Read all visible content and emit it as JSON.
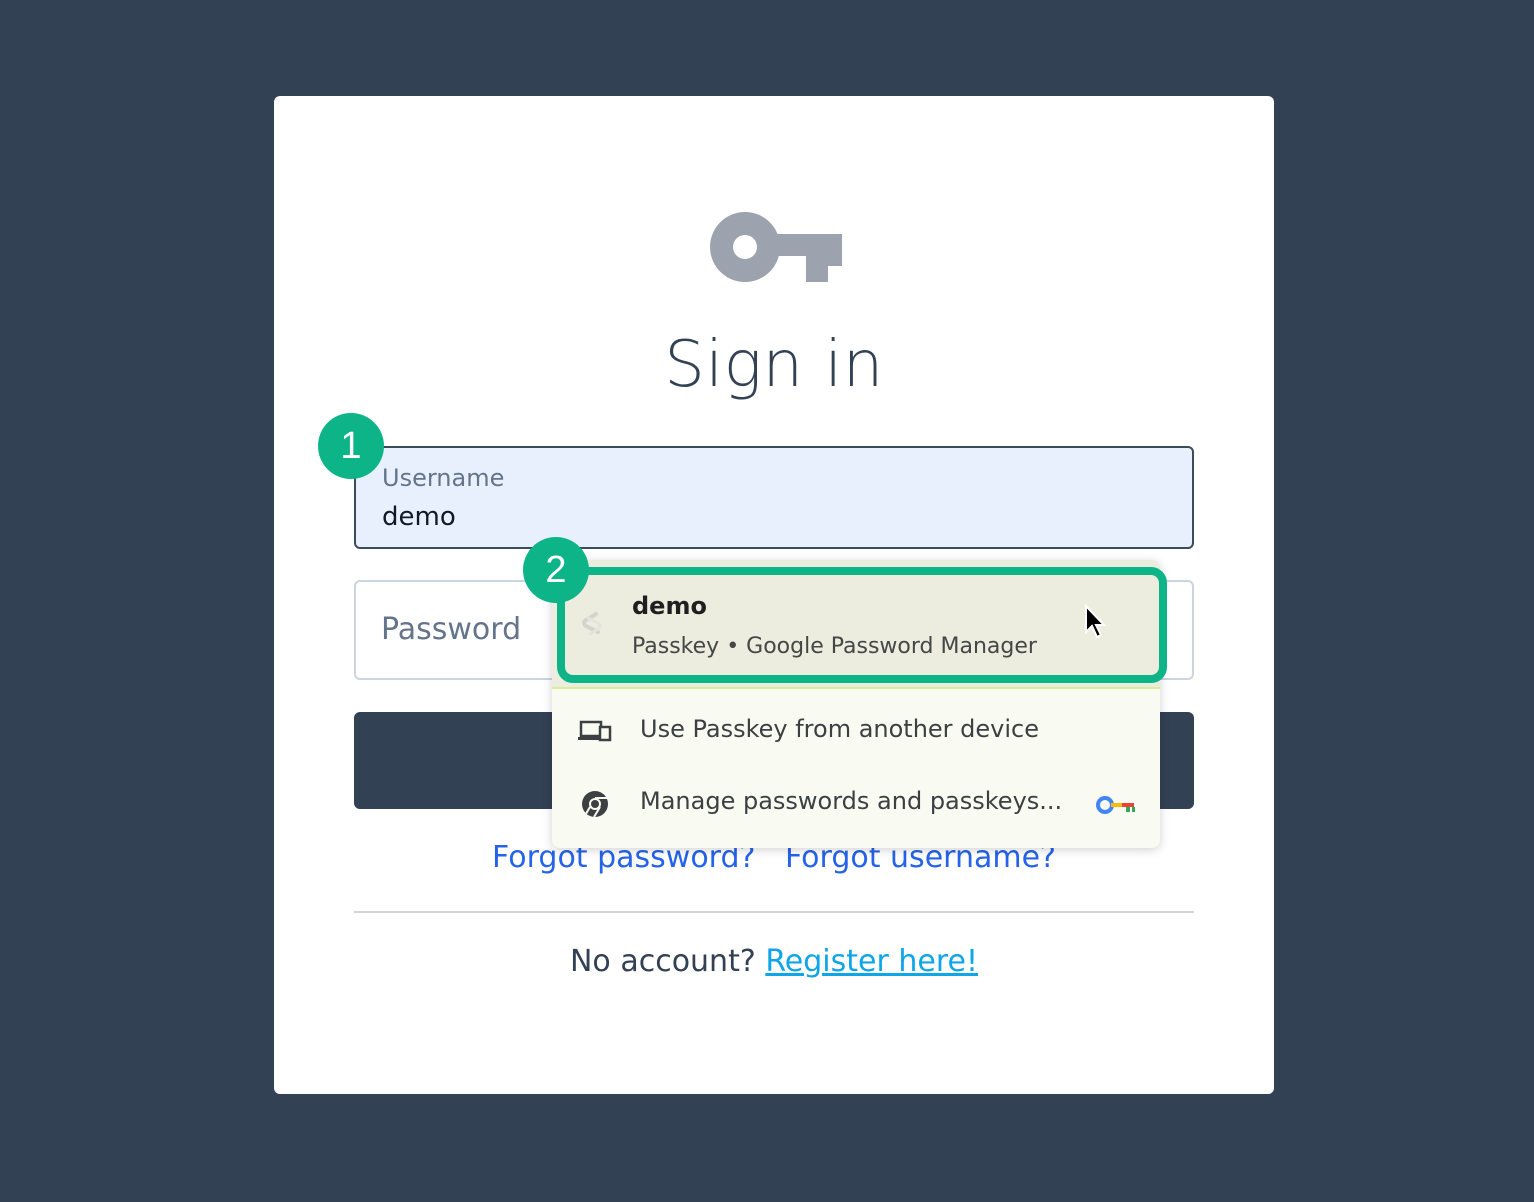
{
  "page": {
    "title": "Sign in",
    "username_field": {
      "label": "Username",
      "value": "demo"
    },
    "password_field": {
      "placeholder": "Password"
    },
    "links": {
      "forgot_password": "Forgot password?",
      "forgot_username": "Forgot username?"
    },
    "register": {
      "prompt": "No account?",
      "link": "Register here!"
    }
  },
  "autofill_dropdown": {
    "selected_entry": {
      "username": "demo",
      "subtitle": "Passkey • Google Password Manager"
    },
    "items": [
      {
        "label": "Use Passkey from another device",
        "icon": "devices-icon"
      },
      {
        "label": "Manage passwords and passkeys...",
        "icon": "chrome-icon"
      }
    ]
  },
  "annotations": {
    "step1": "1",
    "step2": "2"
  },
  "colors": {
    "background": "#334155",
    "accent": "#0db488",
    "link": "#2563eb"
  }
}
